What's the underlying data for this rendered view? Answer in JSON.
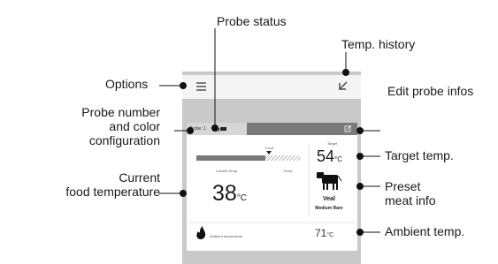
{
  "callouts": {
    "probe_status": "Probe status",
    "temp_history": "Temp. history",
    "options": "Options",
    "edit_probe_infos": "Edit probe infos",
    "probe_number_line1": "Probe number",
    "probe_number_line2": "and color",
    "probe_number_line3": "configuration",
    "target_temp": "Target temp.",
    "current_line1": "Current",
    "current_line2": "food temperature",
    "preset_line1": "Preset",
    "preset_line2": "meat info",
    "ambient_temp": "Ambient temp."
  },
  "screen": {
    "probe_label": "Probe: 1",
    "food_label": "Food",
    "target_label": "Target",
    "target_value": "54",
    "target_unit": "°C",
    "current_label": "Current Temp.",
    "trend_label": "Trend",
    "current_value": "38",
    "current_unit": "°C",
    "meat_name": "Veal",
    "meat_doneness": "Medium Rare",
    "ambient_label": "Ambient temperature",
    "ambient_value": "71",
    "ambient_unit": "°C"
  },
  "icons": {
    "menu": "hamburger-menu-icon",
    "history": "history-arrow-icon",
    "edit": "edit-icon",
    "battery": "battery-icon",
    "signal": "signal-icon",
    "cow": "cow-icon",
    "flame": "flame-icon"
  },
  "colors": {
    "screen_bg": "#c9c9c9",
    "header_dark": "#7a7a7a",
    "text": "#1a1a1a"
  }
}
